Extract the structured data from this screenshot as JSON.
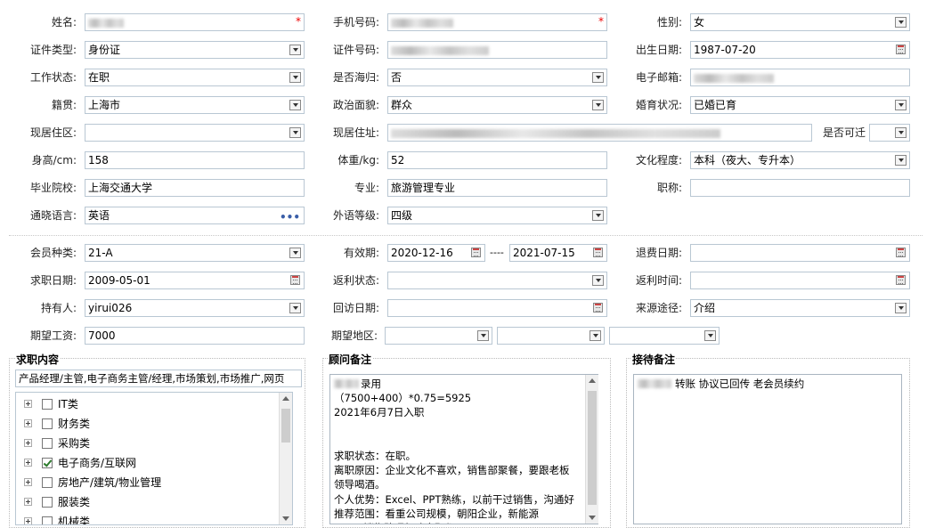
{
  "personal": {
    "name": {
      "label": "姓名:",
      "value": ""
    },
    "phone": {
      "label": "手机号码:",
      "value": ""
    },
    "gender": {
      "label": "性别:",
      "value": "女"
    },
    "id_type": {
      "label": "证件类型:",
      "value": "身份证"
    },
    "id_number": {
      "label": "证件号码:",
      "value": ""
    },
    "birth_date": {
      "label": "出生日期:",
      "value": "1987-07-20"
    },
    "work_status": {
      "label": "工作状态:",
      "value": "在职"
    },
    "returnee": {
      "label": "是否海归:",
      "value": "否"
    },
    "email": {
      "label": "电子邮箱:",
      "value": ""
    },
    "native_place": {
      "label": "籍贯:",
      "value": "上海市"
    },
    "political": {
      "label": "政治面貌:",
      "value": "群众"
    },
    "marital": {
      "label": "婚育状况:",
      "value": "已婚已育"
    },
    "current_area": {
      "label": "现居住区:",
      "value": ""
    },
    "current_address": {
      "label": "现居住址:",
      "value": ""
    },
    "relocatable": {
      "label": "是否可迁",
      "value": ""
    },
    "height": {
      "label": "身高/cm:",
      "value": "158"
    },
    "weight": {
      "label": "体重/kg:",
      "value": "52"
    },
    "education": {
      "label": "文化程度:",
      "value": "本科（夜大、专升本）"
    },
    "school": {
      "label": "毕业院校:",
      "value": "上海交通大学"
    },
    "major": {
      "label": "专业:",
      "value": "旅游管理专业"
    },
    "title": {
      "label": "职称:",
      "value": ""
    },
    "language": {
      "label": "通晓语言:",
      "value": "英语"
    },
    "lang_level": {
      "label": "外语等级:",
      "value": "四级"
    }
  },
  "membership": {
    "member_type": {
      "label": "会员种类:",
      "value": "21-A"
    },
    "valid_period": {
      "label": "有效期:",
      "start": "2020-12-16",
      "separator": "----",
      "end": "2021-07-15"
    },
    "refund_date": {
      "label": "退费日期:",
      "value": ""
    },
    "job_date": {
      "label": "求职日期:",
      "value": "2009-05-01"
    },
    "rebate_status": {
      "label": "返利状态:",
      "value": ""
    },
    "rebate_time": {
      "label": "返利时间:",
      "value": ""
    },
    "holder": {
      "label": "持有人:",
      "value": "yirui026"
    },
    "visit_date": {
      "label": "回访日期:",
      "value": ""
    },
    "source": {
      "label": "来源途径:",
      "value": "介绍"
    },
    "expected_salary": {
      "label": "期望工资:",
      "value": "7000"
    },
    "expected_area": {
      "label": "期望地区:",
      "values": [
        "",
        "",
        ""
      ]
    }
  },
  "job_content": {
    "title": "求职内容",
    "summary": "产品经理/主管,电子商务主管/经理,市场策划,市场推广,网页",
    "tree": [
      {
        "label": "IT类",
        "checked": false
      },
      {
        "label": "财务类",
        "checked": false
      },
      {
        "label": "采购类",
        "checked": false
      },
      {
        "label": "电子商务/互联网",
        "checked": true
      },
      {
        "label": "房地产/建筑/物业管理",
        "checked": false
      },
      {
        "label": "服装类",
        "checked": false
      },
      {
        "label": "机械类",
        "checked": false
      }
    ]
  },
  "advisor_notes": {
    "title": "顾问备注",
    "text": "录用\n（7500+400）*0.75=5925\n2021年6月7日入职\n\n\n求职状态：在职。\n离职原因：企业文化不喜欢，销售部聚餐，要跟老板\n领导喝酒。\n个人优势：Excel、PPT熟练，以前干过销售，沟通好\n推荐范围：看重公司规模，朝阳企业，新能源\n         销售助理行政文职都可以。"
  },
  "reception_notes": {
    "title": "接待备注",
    "text": "转账 协议已回传 老会员续约"
  }
}
